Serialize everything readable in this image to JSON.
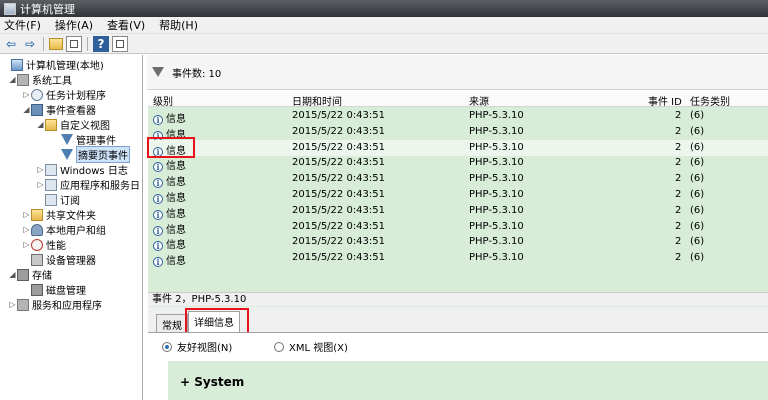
{
  "window": {
    "title": "计算机管理"
  },
  "menu": [
    "文件(F)",
    "操作(A)",
    "查看(V)",
    "帮助(H)"
  ],
  "tree": [
    {
      "label": "计算机管理(本地)",
      "icon": "computer-icon",
      "expander": ""
    },
    {
      "label": "系统工具",
      "icon": "tools-icon",
      "expander": "◢"
    },
    {
      "label": "任务计划程序",
      "icon": "clock-icon",
      "expander": "▷"
    },
    {
      "label": "事件查看器",
      "icon": "event-viewer-icon",
      "expander": "◢"
    },
    {
      "label": "自定义视图",
      "icon": "folder-icon",
      "expander": "◢"
    },
    {
      "label": "管理事件",
      "icon": "filter-icon",
      "expander": ""
    },
    {
      "label": "摘要页事件",
      "icon": "filter-icon",
      "expander": ""
    },
    {
      "label": "Windows 日志",
      "icon": "log-icon",
      "expander": "▷"
    },
    {
      "label": "应用程序和服务日",
      "icon": "log-icon",
      "expander": "▷"
    },
    {
      "label": "订阅",
      "icon": "log-icon",
      "expander": ""
    },
    {
      "label": "共享文件夹",
      "icon": "shared-folder-icon",
      "expander": "▷"
    },
    {
      "label": "本地用户和组",
      "icon": "users-icon",
      "expander": "▷"
    },
    {
      "label": "性能",
      "icon": "performance-icon",
      "expander": "▷"
    },
    {
      "label": "设备管理器",
      "icon": "device-manager-icon",
      "expander": ""
    },
    {
      "label": "存储",
      "icon": "storage-icon",
      "expander": "◢"
    },
    {
      "label": "磁盘管理",
      "icon": "disk-icon",
      "expander": ""
    },
    {
      "label": "服务和应用程序",
      "icon": "services-icon",
      "expander": "▷"
    }
  ],
  "pane": {
    "event_count": "事件数: 10"
  },
  "columns": {
    "level": "级别",
    "datetime": "日期和时间",
    "source": "来源",
    "event_id": "事件 ID",
    "task": "任务类别"
  },
  "rows": [
    {
      "level": "信息",
      "datetime": "2015/5/22 0:43:51",
      "source": "PHP-5.3.10",
      "event_id": "2",
      "task": "(6)"
    },
    {
      "level": "信息",
      "datetime": "2015/5/22 0:43:51",
      "source": "PHP-5.3.10",
      "event_id": "2",
      "task": "(6)"
    },
    {
      "level": "信息",
      "datetime": "2015/5/22 0:43:51",
      "source": "PHP-5.3.10",
      "event_id": "2",
      "task": "(6)"
    },
    {
      "level": "信息",
      "datetime": "2015/5/22 0:43:51",
      "source": "PHP-5.3.10",
      "event_id": "2",
      "task": "(6)"
    },
    {
      "level": "信息",
      "datetime": "2015/5/22 0:43:51",
      "source": "PHP-5.3.10",
      "event_id": "2",
      "task": "(6)"
    },
    {
      "level": "信息",
      "datetime": "2015/5/22 0:43:51",
      "source": "PHP-5.3.10",
      "event_id": "2",
      "task": "(6)"
    },
    {
      "level": "信息",
      "datetime": "2015/5/22 0:43:51",
      "source": "PHP-5.3.10",
      "event_id": "2",
      "task": "(6)"
    },
    {
      "level": "信息",
      "datetime": "2015/5/22 0:43:51",
      "source": "PHP-5.3.10",
      "event_id": "2",
      "task": "(6)"
    },
    {
      "level": "信息",
      "datetime": "2015/5/22 0:43:51",
      "source": "PHP-5.3.10",
      "event_id": "2",
      "task": "(6)"
    },
    {
      "level": "信息",
      "datetime": "2015/5/22 0:43:51",
      "source": "PHP-5.3.10",
      "event_id": "2",
      "task": "(6)"
    }
  ],
  "detail": {
    "header": "事件 2，PHP-5.3.10",
    "tabs": [
      "常规",
      "详细信息"
    ],
    "radio_friendly": "友好视图(N)",
    "radio_xml": "XML 视图(X)",
    "section": "+ System"
  },
  "colors": {
    "grid_green": "#d7edd8",
    "highlight_red": "#e8121b"
  }
}
